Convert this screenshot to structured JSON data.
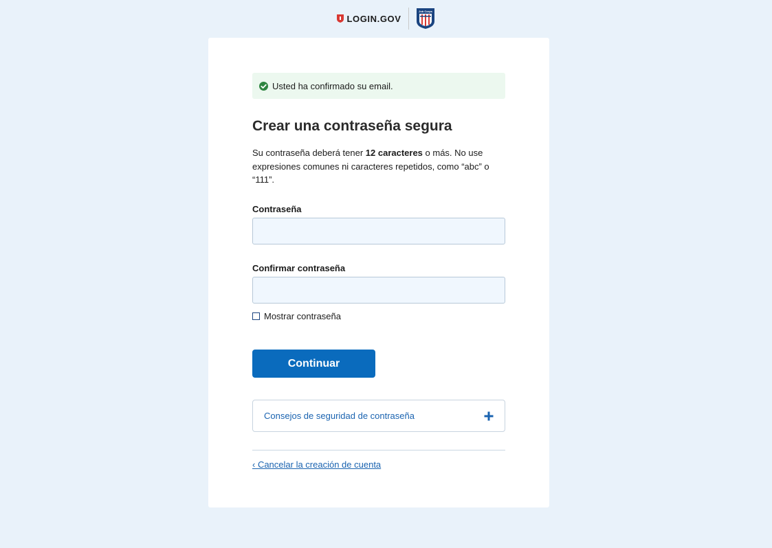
{
  "header": {
    "brand": "LOGIN.GOV",
    "partner_logo_text": "Job Corps"
  },
  "alert": {
    "text": "Usted ha confirmado su email.",
    "status_color": "#2e8540"
  },
  "form": {
    "title": "Crear una contraseña segura",
    "description_prefix": "Su contraseña deberá tener ",
    "description_bold": "12 caracteres",
    "description_suffix": " o más. No use expresiones comunes ni caracteres repetidos, como “abc” o “111”.",
    "password_label": "Contraseña",
    "password_value": "",
    "confirm_label": "Confirmar contraseña",
    "confirm_value": "",
    "show_password_label": "Mostrar contraseña",
    "show_password_checked": false,
    "submit_label": "Continuar",
    "accordion_label": "Consejos de seguridad de contraseña",
    "accordion_expanded": false,
    "cancel_link": "‹ Cancelar la creación de cuenta"
  },
  "colors": {
    "page_bg": "#e9f2fa",
    "primary": "#0a6bbd",
    "link": "#1a63b0"
  }
}
